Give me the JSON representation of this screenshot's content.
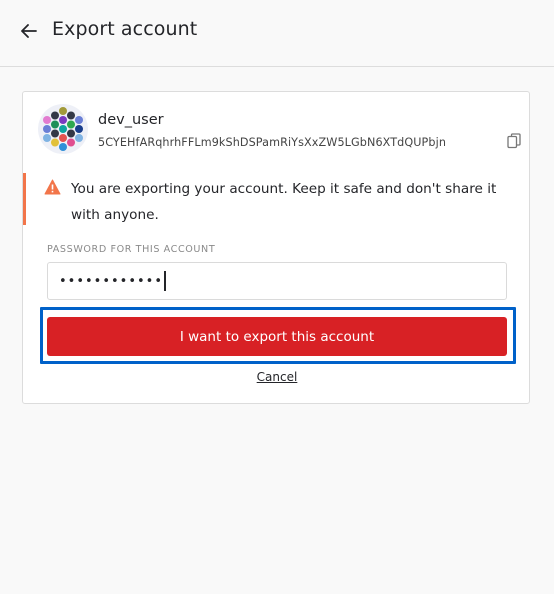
{
  "header": {
    "title": "Export account",
    "back_icon": "arrow-left-icon"
  },
  "account": {
    "name": "dev_user",
    "address": "5CYEHfARqhrhFFLm9kShDSPamRiYsXxZW5LGbN6XTdQUPbjn",
    "avatar_icon": "identicon-icon",
    "copy_icon": "copy-icon"
  },
  "warning": {
    "text": "You are exporting your account. Keep it safe and don't share it with anyone.",
    "icon": "warning-triangle-icon",
    "accent_color": "#f2754a"
  },
  "password": {
    "label": "PASSWORD FOR THIS ACCOUNT",
    "value": "••••••••••••"
  },
  "actions": {
    "export_label": "I want to export this account",
    "export_color": "#d82125",
    "focus_color": "#0061c9",
    "cancel_label": "Cancel"
  }
}
